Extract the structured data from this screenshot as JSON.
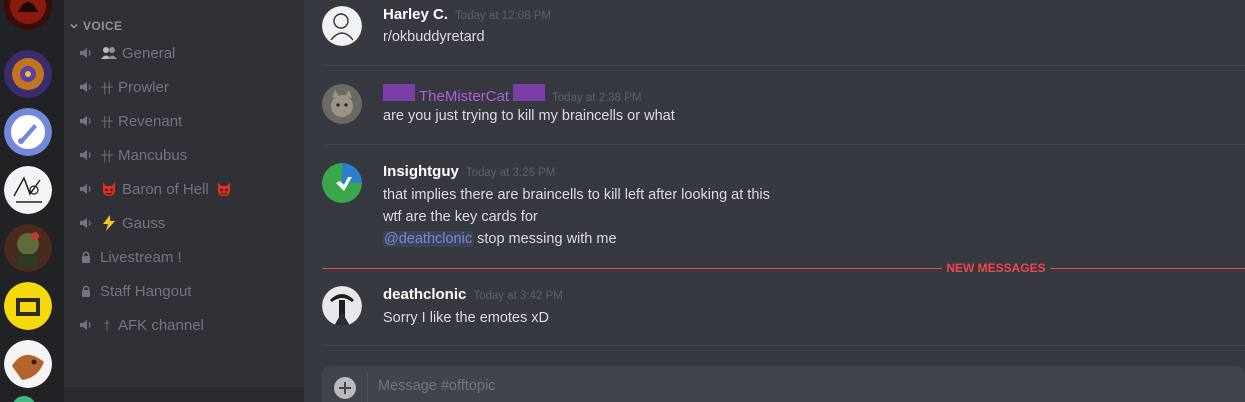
{
  "sidebar": {
    "voice_header": "VOICE",
    "channels": [
      {
        "label": "General",
        "icon": "speaker-icon",
        "emoji": "people-icon"
      },
      {
        "label": "Prowler",
        "icon": "speaker-icon",
        "glyph": "卄"
      },
      {
        "label": "Revenant",
        "icon": "speaker-icon",
        "glyph": "卄"
      },
      {
        "label": "Mancubus",
        "icon": "speaker-icon",
        "glyph": "卄"
      },
      {
        "label": "Baron of Hell",
        "icon": "speaker-icon",
        "emoji": "imp-icon"
      },
      {
        "label": "Gauss",
        "icon": "speaker-icon",
        "emoji": "lightning-icon"
      },
      {
        "label": "Livestream !",
        "icon": "lock-icon"
      },
      {
        "label": "Staff Hangout",
        "icon": "lock-icon"
      },
      {
        "label": "AFK channel",
        "icon": "speaker-icon",
        "glyph": "†"
      }
    ]
  },
  "messages": [
    {
      "username": "Harley C.",
      "timestamp": "Today at 12:08 PM",
      "lines": [
        "r/okbuddyretard"
      ]
    },
    {
      "username": "TheMisterCat",
      "timestamp": "Today at 2:38 PM",
      "lines": [
        "are you just trying to kill my braincells or what"
      ]
    },
    {
      "username": "Insightguy",
      "timestamp": "Today at 3:26 PM",
      "lines": [
        "that implies there are braincells to kill left after looking at this",
        "wtf are the key cards for"
      ],
      "mention": "@deathclonic",
      "mention_rest": " stop messing with me"
    },
    {
      "username": "deathclonic",
      "timestamp": "Today at 3:42 PM",
      "lines": [
        "Sorry I like the emotes xD"
      ]
    }
  ],
  "new_messages_label": "NEW MESSAGES",
  "composer": {
    "placeholder": "Message #offtopic"
  },
  "colors": {
    "accent": "#7289da",
    "new_messages": "#f04747",
    "role_purple": "#b25ede"
  }
}
